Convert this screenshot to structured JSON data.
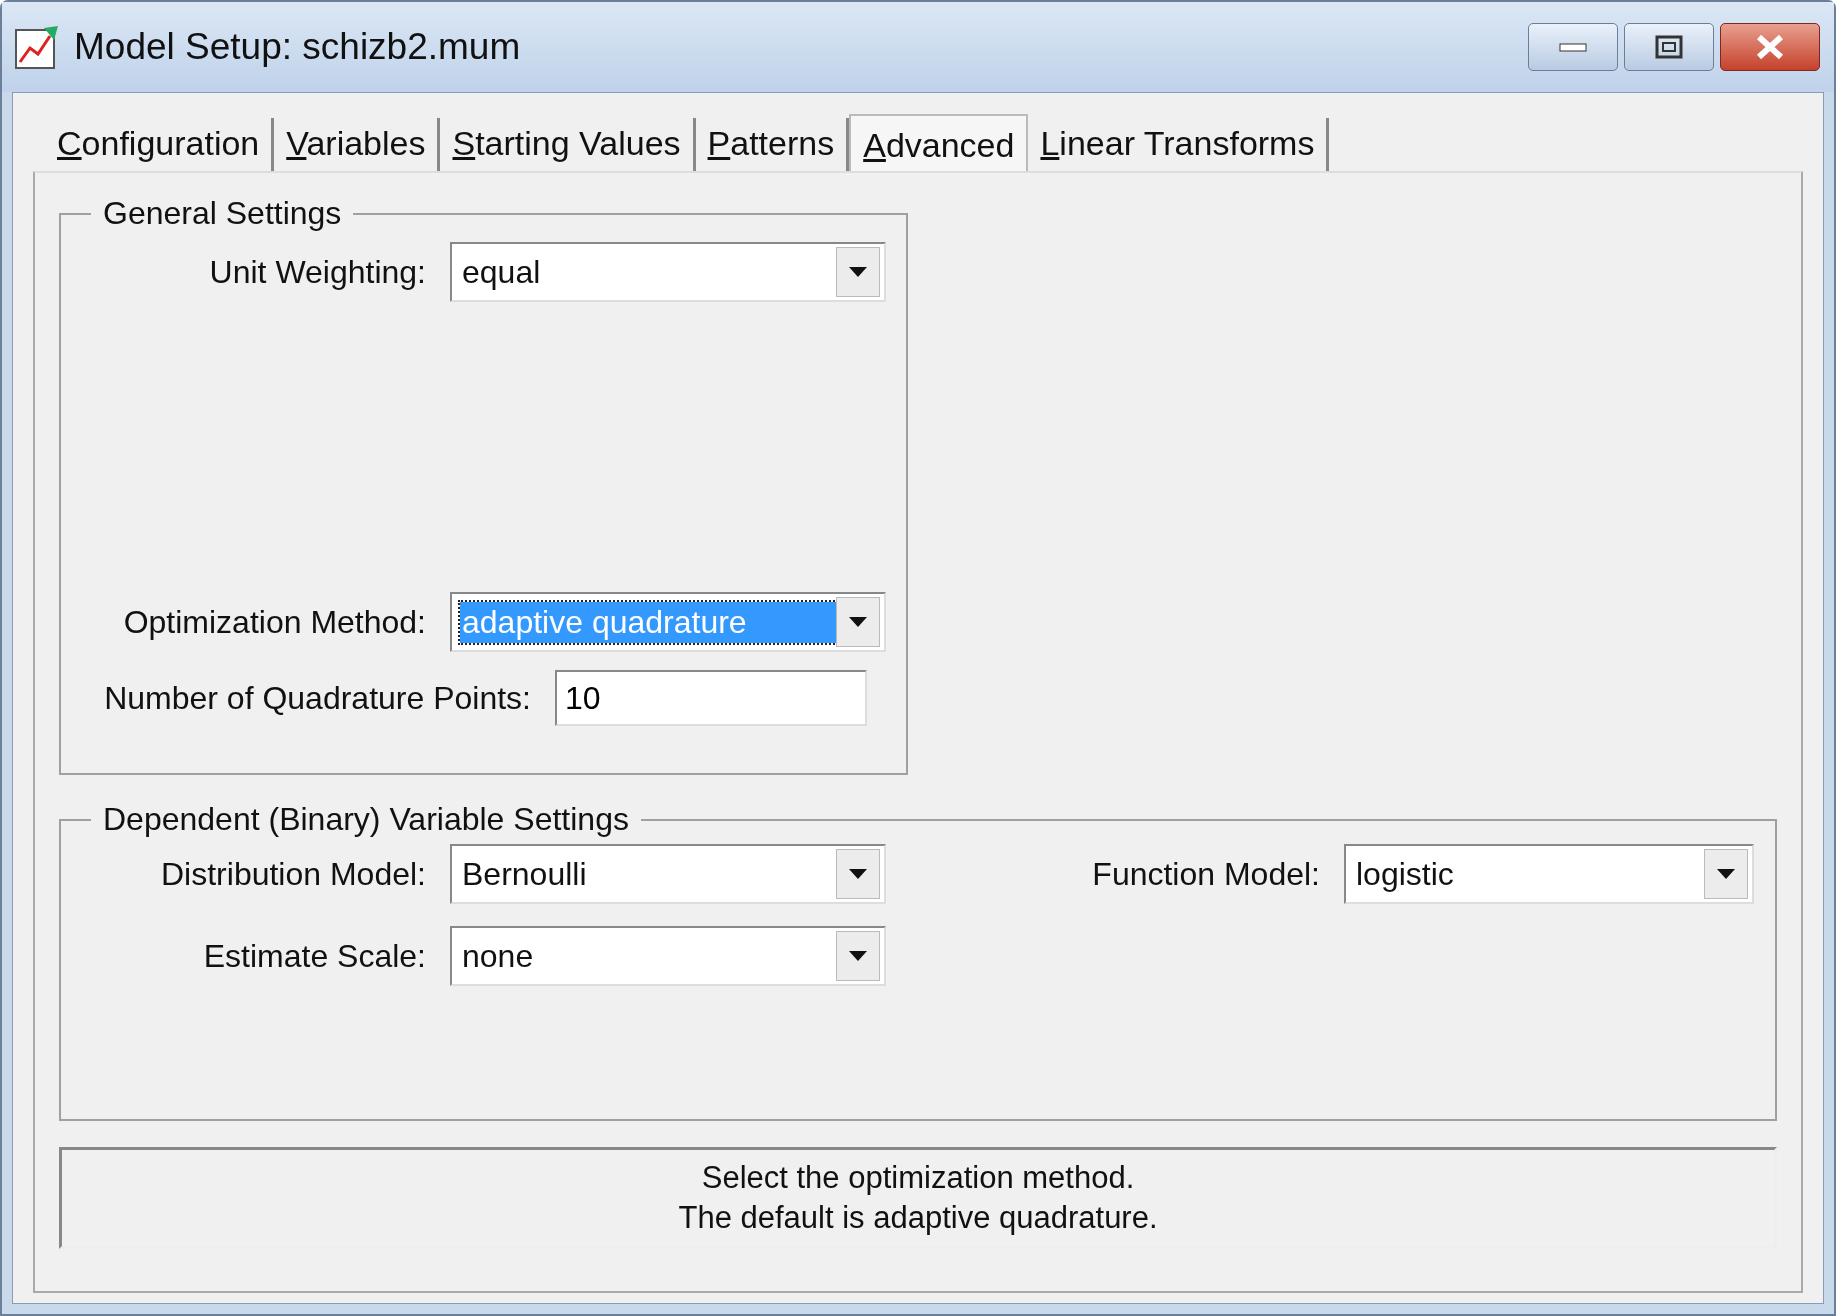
{
  "window": {
    "title": "Model Setup: schizb2.mum"
  },
  "tabs": [
    {
      "label": "Configuration",
      "selected": false
    },
    {
      "label": "Variables",
      "selected": false
    },
    {
      "label": "Starting Values",
      "selected": false
    },
    {
      "label": "Patterns",
      "selected": false
    },
    {
      "label": "Advanced",
      "selected": true
    },
    {
      "label": "Linear Transforms",
      "selected": false
    }
  ],
  "general_settings": {
    "title": "General Settings",
    "unit_weighting": {
      "label": "Unit Weighting:",
      "value": "equal",
      "highlighted": false
    },
    "optimization_method": {
      "label": "Optimization Method:",
      "value": "adaptive quadrature",
      "highlighted": true
    },
    "quadrature_points": {
      "label": "Number of Quadrature Points:",
      "value": "10"
    }
  },
  "dependent_settings": {
    "title": "Dependent (Binary) Variable Settings",
    "distribution_model": {
      "label": "Distribution Model:",
      "value": "Bernoulli",
      "highlighted": false
    },
    "function_model": {
      "label": "Function Model:",
      "value": "logistic",
      "highlighted": false
    },
    "estimate_scale": {
      "label": "Estimate Scale:",
      "value": "none",
      "highlighted": false
    }
  },
  "status_message": [
    "Select the optimization method.",
    "The default is adaptive quadrature."
  ]
}
